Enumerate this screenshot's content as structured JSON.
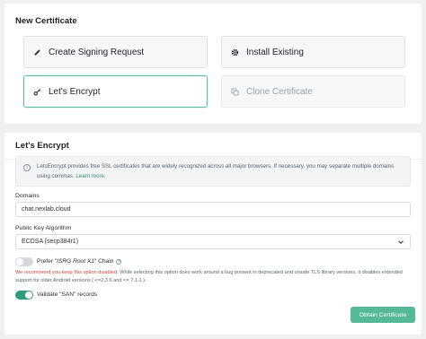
{
  "new_certificate": {
    "title": "New Certificate",
    "options": {
      "create_signing_request": "Create Signing Request",
      "install_existing": "Install Existing",
      "lets_encrypt": "Let's Encrypt",
      "clone_certificate": "Clone Certificate"
    },
    "selected": "Let's Encrypt",
    "icons": {
      "create_signing_request": "pencil-icon",
      "install_existing": "gear-icon",
      "lets_encrypt": "key-icon",
      "clone_certificate": "copy-icon"
    }
  },
  "lets_encrypt": {
    "title": "Let's Encrypt",
    "info_text": "LetsEncrypt provides free SSL certificates that are widely recognized across all major browsers. If necessary, you may separate multiple domains using commas.",
    "learn_more": "Learn more.",
    "domains": {
      "label": "Domains",
      "value": "chat.nexlab.cloud"
    },
    "algorithm": {
      "label": "Public Key Algorithm",
      "value": "ECDSA (secp384r1)"
    },
    "prefer_chain": {
      "label_prefix": "Prefer \"",
      "label_em": "ISRG Root X1",
      "label_suffix": "\" Chain",
      "enabled": false,
      "warning_red": "We recommend you keep this option disabled.",
      "warning_line1": " While selecting this option does work around a bug present in deprecated and unsafe TLS library versions, it disables extended",
      "warning_line2": "support for older Android versions ( <=2.3.6 and <= 7.1.1 )."
    },
    "validate_san": {
      "label": "Validate \"SAN\" records",
      "enabled": true
    },
    "submit_label": "Obtain Certificate"
  },
  "colors": {
    "accent": "#2f9e7c",
    "button": "#56b996",
    "selected_border": "#5fc0a0",
    "warning": "#d14343"
  }
}
